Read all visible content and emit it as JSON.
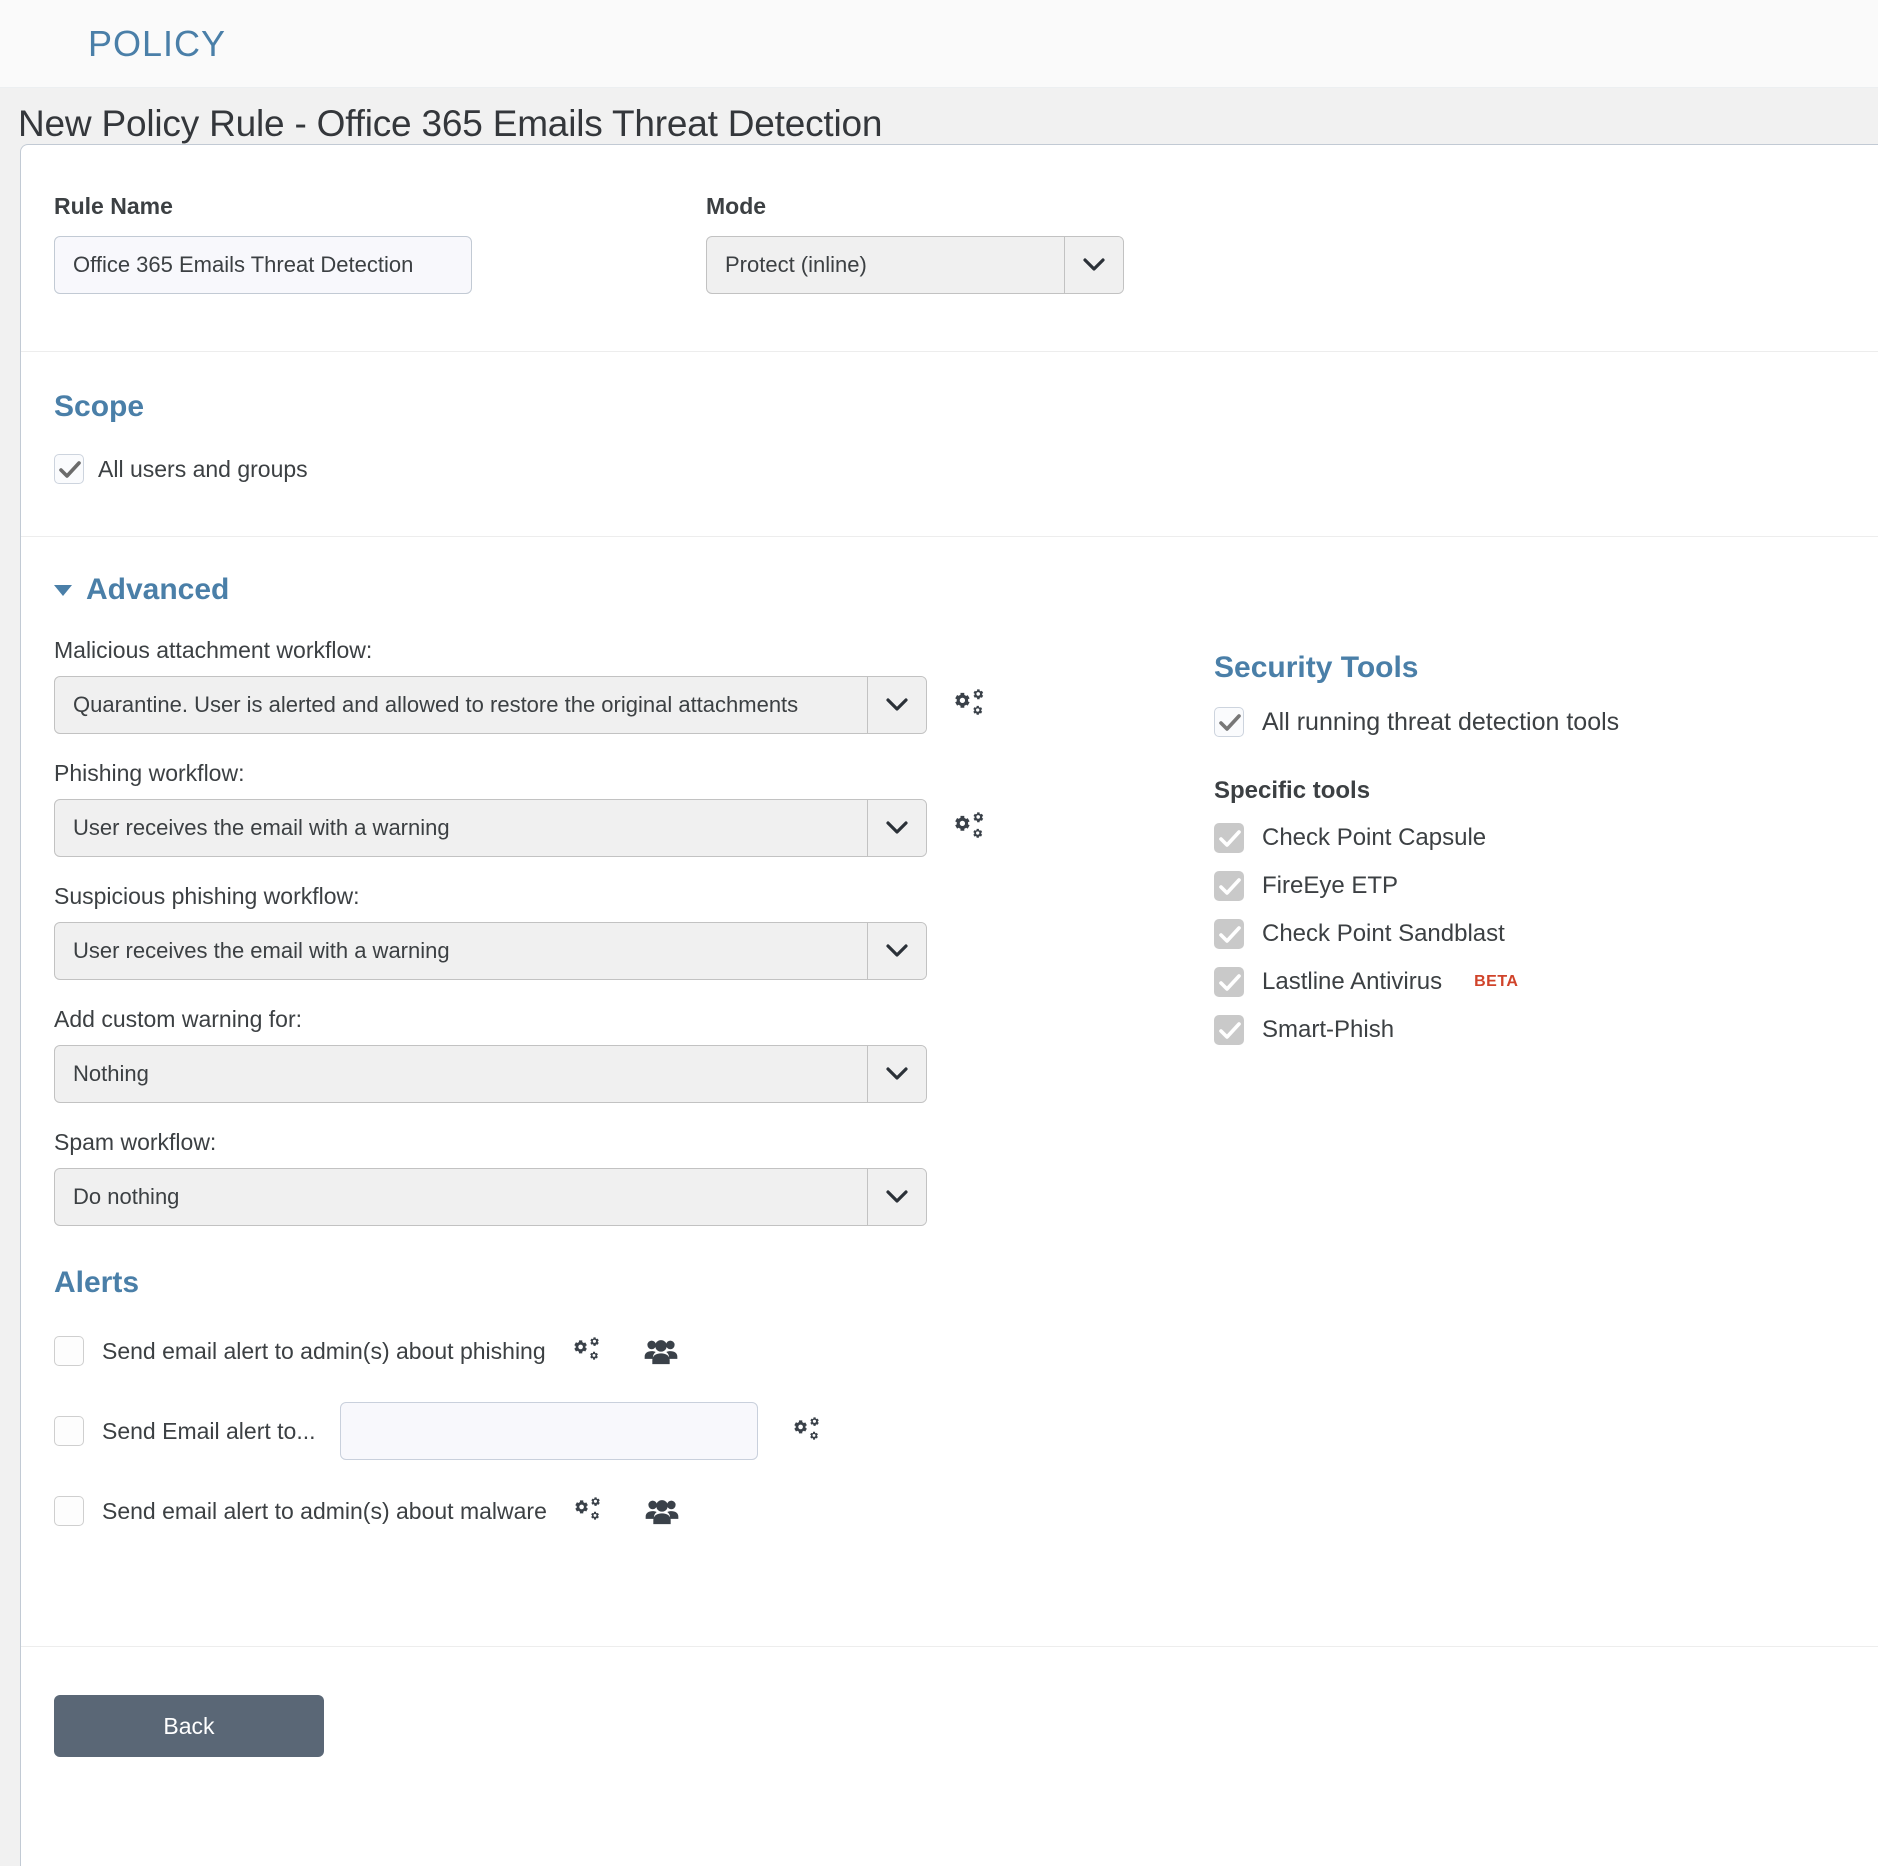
{
  "topbar": {
    "title": "POLICY"
  },
  "page": {
    "heading": "New Policy Rule - Office 365 Emails Threat Detection"
  },
  "form": {
    "rule_name_label": "Rule Name",
    "rule_name_value": "Office 365 Emails Threat Detection",
    "rule_name_placeholder": "",
    "mode_label": "Mode",
    "mode_value": "Protect (inline)"
  },
  "scope": {
    "title": "Scope",
    "all_users_label": "All users and groups",
    "all_users_checked": true
  },
  "advanced": {
    "title": "Advanced",
    "expanded": true,
    "workflows": [
      {
        "label": "Malicious attachment workflow:",
        "value": "Quarantine. User is alerted and allowed to restore the original attachments",
        "has_cogs": true
      },
      {
        "label": "Phishing workflow:",
        "value": "User receives the email with a warning",
        "has_cogs": true
      },
      {
        "label": "Suspicious phishing workflow:",
        "value": "User receives the email with a warning",
        "has_cogs": false
      },
      {
        "label": "Add custom warning for:",
        "value": "Nothing",
        "has_cogs": false
      },
      {
        "label": "Spam workflow:",
        "value": "Do nothing",
        "has_cogs": false
      }
    ]
  },
  "security_tools": {
    "title": "Security Tools",
    "all_running_label": "All running threat detection tools",
    "all_running_checked": true,
    "specific_title": "Specific tools",
    "items": [
      {
        "label": "Check Point Capsule",
        "checked": true,
        "badge": ""
      },
      {
        "label": "FireEye ETP",
        "checked": true,
        "badge": ""
      },
      {
        "label": "Check Point Sandblast",
        "checked": true,
        "badge": ""
      },
      {
        "label": "Lastline Antivirus",
        "checked": true,
        "badge": "BETA"
      },
      {
        "label": "Smart-Phish",
        "checked": true,
        "badge": ""
      }
    ]
  },
  "alerts": {
    "title": "Alerts",
    "rows": [
      {
        "label": "Send email alert to admin(s) about phishing",
        "checked": false,
        "type": "icons"
      },
      {
        "label": "Send Email alert to...",
        "checked": false,
        "type": "input",
        "value": "",
        "placeholder": ""
      },
      {
        "label": "Send email alert to admin(s) about malware",
        "checked": false,
        "type": "icons"
      }
    ]
  },
  "footer": {
    "back_label": "Back"
  },
  "colors": {
    "accent_blue": "#4a7fa8",
    "beta_orange": "#d0432a",
    "button_slate": "#5a6776",
    "icon_dark": "#3a4149"
  }
}
